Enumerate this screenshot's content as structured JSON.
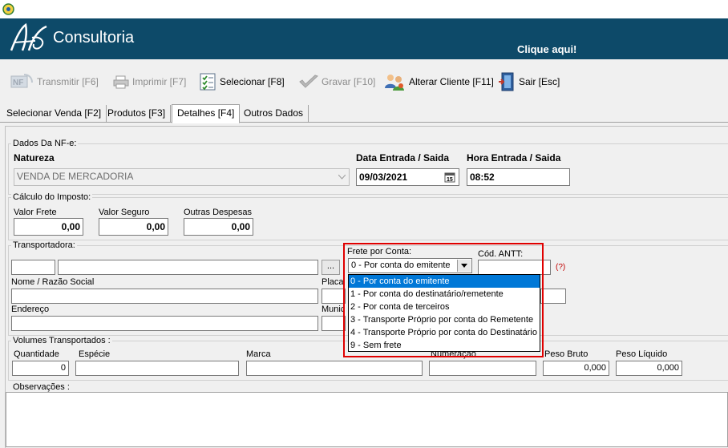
{
  "header": {
    "brand": "Consultoria",
    "cta": "Clique aqui!"
  },
  "toolbar": {
    "transmitir": "Transmitir [F6]",
    "imprimir": "Imprimir  [F7]",
    "selecionar": "Selecionar [F8]",
    "gravar": "Gravar [F10]",
    "alterar": "Alterar Cliente [F11]",
    "sair": "Sair   [Esc]"
  },
  "tabs": [
    "Selecionar Venda [F2]",
    "Produtos [F3]",
    "Detalhes [F4]",
    "Outros Dados"
  ],
  "nfe": {
    "group": "Dados Da NF-e:",
    "natureza_label": "Natureza",
    "natureza_value": "VENDA DE MERCADORIA",
    "data_label": "Data Entrada / Saida",
    "data_value": "09/03/2021",
    "hora_label": "Hora Entrada / Saida",
    "hora_value": "08:52"
  },
  "imposto": {
    "group": "Cálculo do Imposto:",
    "frete_label": "Valor Frete",
    "frete_value": "0,00",
    "seguro_label": "Valor Seguro",
    "seguro_value": "0,00",
    "outras_label": "Outras Despesas",
    "outras_value": "0,00"
  },
  "transportadora": {
    "group": "Transportadora:",
    "browse": "...",
    "nome_label": "Nome / Razão Social",
    "placa_label": "Placa",
    "endereco_label": "Endereço",
    "municipio_label": "Munic",
    "frete_conta_label": "Frete por Conta:",
    "frete_conta_value": "0 - Por conta do emitente",
    "antt_label": "Cód. ANTT:",
    "antt_hint": "(?)",
    "options": [
      "0 - Por conta do emitente",
      "1 - Por conta do destinatário/remetente",
      "2 - Por conta de terceiros",
      "3 - Transporte Próprio por conta do Remetente",
      "4 - Transporte Próprio por conta do Destinatário",
      "9 - Sem frete"
    ]
  },
  "volumes": {
    "group": "Volumes Transportados :",
    "quantidade_label": "Quantidade",
    "quantidade_value": "0",
    "especie_label": "Espécie",
    "marca_label": "Marca",
    "numeracao_label": "Numeração",
    "peso_bruto_label": "Peso Bruto",
    "peso_bruto_value": "0,000",
    "peso_liquido_label": "Peso Líquido",
    "peso_liquido_value": "0,000"
  },
  "observacoes": {
    "label": "Observações :"
  }
}
